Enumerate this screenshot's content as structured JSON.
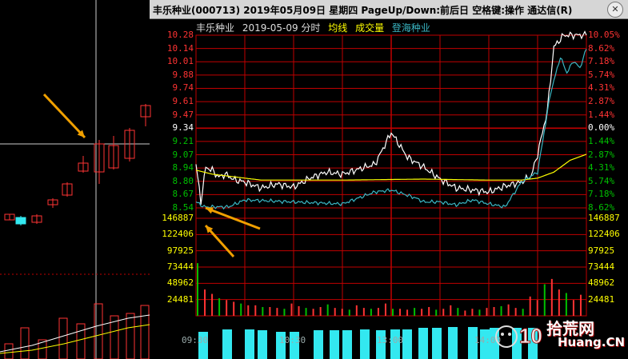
{
  "window": {
    "title": "丰乐种业(000713)  2019年05月09日  星期四  PageUp/Down:前后日  空格键:操作  通达信(R)",
    "close_symbol": "✕"
  },
  "legend": {
    "stock": "丰乐种业",
    "date_label": "2019-05-09 分时",
    "avg_line": "均线",
    "volume": "成交量",
    "compare": "登海种业"
  },
  "colors": {
    "background": "#000000",
    "grid": "#c00000",
    "price_line": "#ffffff",
    "avg_line": "#ffff00",
    "compare_line": "#3ab7c4",
    "up": "#ff3333",
    "down": "#00c000",
    "neutral": "#ffffff",
    "volume_axis": "#ffff00",
    "arrow": "#f0a000",
    "bg_up_candle": "#ff3333",
    "bg_down_bar": "#33e8f0"
  },
  "left_price_axis": [
    "10.28",
    "10.14",
    "10.01",
    "9.88",
    "9.74",
    "9.61",
    "9.47",
    "9.34",
    "9.21",
    "9.07",
    "8.94",
    "8.80",
    "8.67",
    "8.54"
  ],
  "right_pct_axis": [
    "10.05%",
    "8.62%",
    "7.18%",
    "5.74%",
    "4.31%",
    "2.87%",
    "1.44%",
    "0.00%",
    "1.44%",
    "2.87%",
    "4.31%",
    "5.74%",
    "7.18%",
    "8.62%"
  ],
  "volume_axis_left": [
    "146887",
    "122406",
    "97925",
    "73444",
    "48962",
    "24481"
  ],
  "volume_axis_right": [
    "146887",
    "122406",
    "97925",
    "73444",
    "48962",
    "24481"
  ],
  "time_axis": [
    "09:30",
    "10:30",
    "13:00",
    "14:00"
  ],
  "watermark": {
    "text": "拾荒网",
    "url": "Huang.CN",
    "brand_digits": "10"
  },
  "chart_data": {
    "type": "line",
    "title": "丰乐种业 2019-05-09 分时",
    "prev_close": 9.34,
    "ylim": [
      8.54,
      10.28
    ],
    "x_ticks": [
      "09:30",
      "10:30",
      "13:00",
      "14:00"
    ],
    "series": [
      {
        "name": "丰乐种业",
        "x_minute": [
          0,
          3,
          6,
          10,
          14,
          18,
          24,
          30,
          40,
          50,
          60,
          70,
          80,
          90,
          100,
          110,
          120,
          130,
          140,
          150,
          160,
          170,
          180,
          190,
          200,
          206,
          210,
          216,
          220,
          226,
          230,
          234,
          238,
          240
        ],
        "y": [
          8.98,
          8.6,
          8.95,
          8.92,
          8.85,
          8.88,
          8.82,
          8.8,
          8.74,
          8.78,
          8.75,
          8.84,
          8.9,
          8.88,
          8.93,
          8.98,
          9.3,
          9.05,
          8.95,
          8.83,
          8.74,
          8.72,
          8.7,
          8.76,
          8.8,
          8.86,
          9.08,
          9.52,
          10.16,
          10.28,
          10.28,
          10.28,
          10.28,
          10.28
        ]
      },
      {
        "name": "均线",
        "x_minute": [
          0,
          10,
          40,
          90,
          140,
          180,
          200,
          210,
          220,
          230,
          240
        ],
        "y": [
          8.92,
          8.88,
          8.82,
          8.82,
          8.83,
          8.82,
          8.82,
          8.84,
          8.9,
          9.02,
          9.08
        ]
      },
      {
        "name": "登海种业",
        "x_minute": [
          0,
          5,
          20,
          30,
          60,
          90,
          110,
          120,
          135,
          140,
          150,
          160,
          170,
          180,
          190,
          200,
          210,
          218,
          224,
          228,
          232,
          236,
          240
        ],
        "y": [
          8.6,
          8.55,
          8.55,
          8.62,
          8.6,
          8.58,
          8.7,
          8.72,
          8.64,
          8.6,
          8.6,
          8.57,
          8.62,
          8.58,
          8.55,
          8.8,
          8.9,
          9.7,
          10.06,
          9.9,
          10.02,
          9.95,
          10.14
        ]
      }
    ],
    "volume": [
      60,
      30,
      25,
      20,
      18,
      16,
      14,
      12,
      12,
      10,
      10,
      9,
      8,
      14,
      11,
      9,
      8,
      10,
      13,
      9,
      8,
      7,
      12,
      9,
      8,
      9,
      14,
      8,
      8,
      7,
      9,
      8,
      10,
      7,
      8,
      12,
      9,
      6,
      8,
      7,
      9,
      10,
      11,
      13,
      9,
      8,
      22,
      18,
      36,
      42,
      30,
      26,
      18,
      24
    ]
  }
}
